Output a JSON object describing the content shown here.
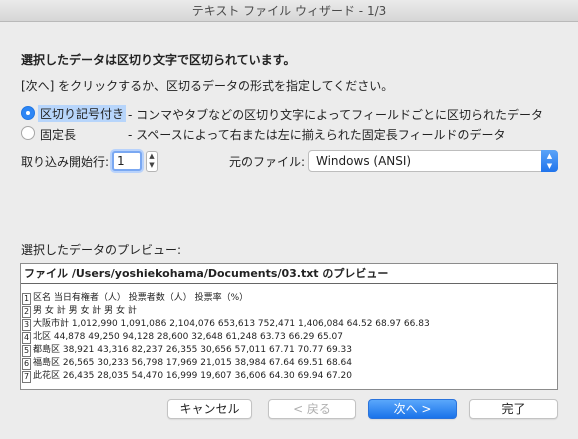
{
  "window": {
    "title": "テキスト ファイル ウィザード - 1/3"
  },
  "instructions": {
    "heading": "選択したデータは区切り文字で区切られています。",
    "subtext": "[次へ] をクリックするか、区切るデータの形式を指定してください。"
  },
  "data_type": {
    "options": [
      {
        "label": "区切り記号付き",
        "description": "- コンマやタブなどの区切り文字によってフィールドごとに区切られたデータ",
        "selected": true
      },
      {
        "label": "固定長",
        "description": "- スペースによって右または左に揃えられた固定長フィールドのデータ",
        "selected": false
      }
    ]
  },
  "start_row": {
    "label": "取り込み開始行:",
    "value": "1"
  },
  "origin": {
    "label": "元のファイル:",
    "value": "Windows (ANSI)"
  },
  "preview": {
    "label": "選択したデータのプレビュー:",
    "title": "ファイル /Users/yoshiekohama/Documents/03.txt のプレビュー",
    "rows": [
      {
        "num": "1",
        "text": "区名 当日有権者（人） 投票者数（人） 投票率（%）"
      },
      {
        "num": "2",
        "text": "男 女 計 男 女 計 男 女 計"
      },
      {
        "num": "3",
        "text": "大阪市計 1,012,990 1,091,086 2,104,076 653,613 752,471 1,406,084 64.52 68.97 66.83"
      },
      {
        "num": "4",
        "text": "北区 44,878 49,250 94,128 28,600 32,648 61,248 63.73 66.29 65.07"
      },
      {
        "num": "5",
        "text": "都島区 38,921 43,316 82,237 26,355 30,656 57,011 67.71 70.77 69.33"
      },
      {
        "num": "6",
        "text": "福島区 26,565 30,233 56,798 17,969 21,015 38,984 67.64 69.51 68.64"
      },
      {
        "num": "7",
        "text": "此花区 26,435 28,035 54,470 16,999 19,607 36,606 64.30 69.94 67.20"
      }
    ]
  },
  "buttons": {
    "cancel": "キャンセル",
    "back": "< 戻る",
    "next": "次へ >",
    "finish": "完了"
  }
}
